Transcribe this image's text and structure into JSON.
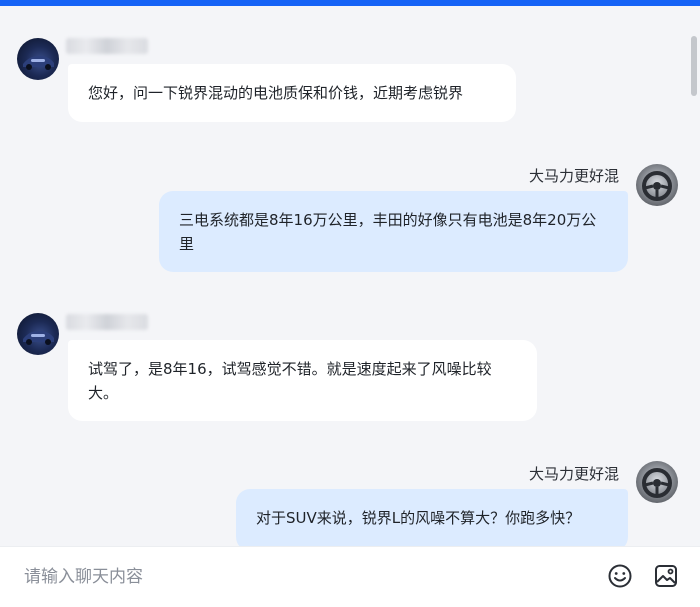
{
  "messages": [
    {
      "side": "left",
      "sender": "",
      "text": "您好，问一下锐界混动的电池质保和价钱，近期考虑锐界"
    },
    {
      "side": "right",
      "sender": "大马力更好混",
      "text": "三电系统都是8年16万公里，丰田的好像只有电池是8年20万公里"
    },
    {
      "side": "left",
      "sender": "",
      "text": "试驾了，是8年16，试驾感觉不错。就是速度起来了风噪比较大。"
    },
    {
      "side": "right",
      "sender": "大马力更好混",
      "text": "对于SUV来说，锐界L的风噪不算大？你跑多快？"
    }
  ],
  "composer": {
    "placeholder": "请输入聊天内容",
    "value": "",
    "emoji_icon": "smile-icon",
    "image_icon": "image-icon"
  },
  "colors": {
    "accent": "#1663f6",
    "background": "#f4f5f8",
    "left_bubble": "#ffffff",
    "right_bubble": "#dcebff"
  }
}
